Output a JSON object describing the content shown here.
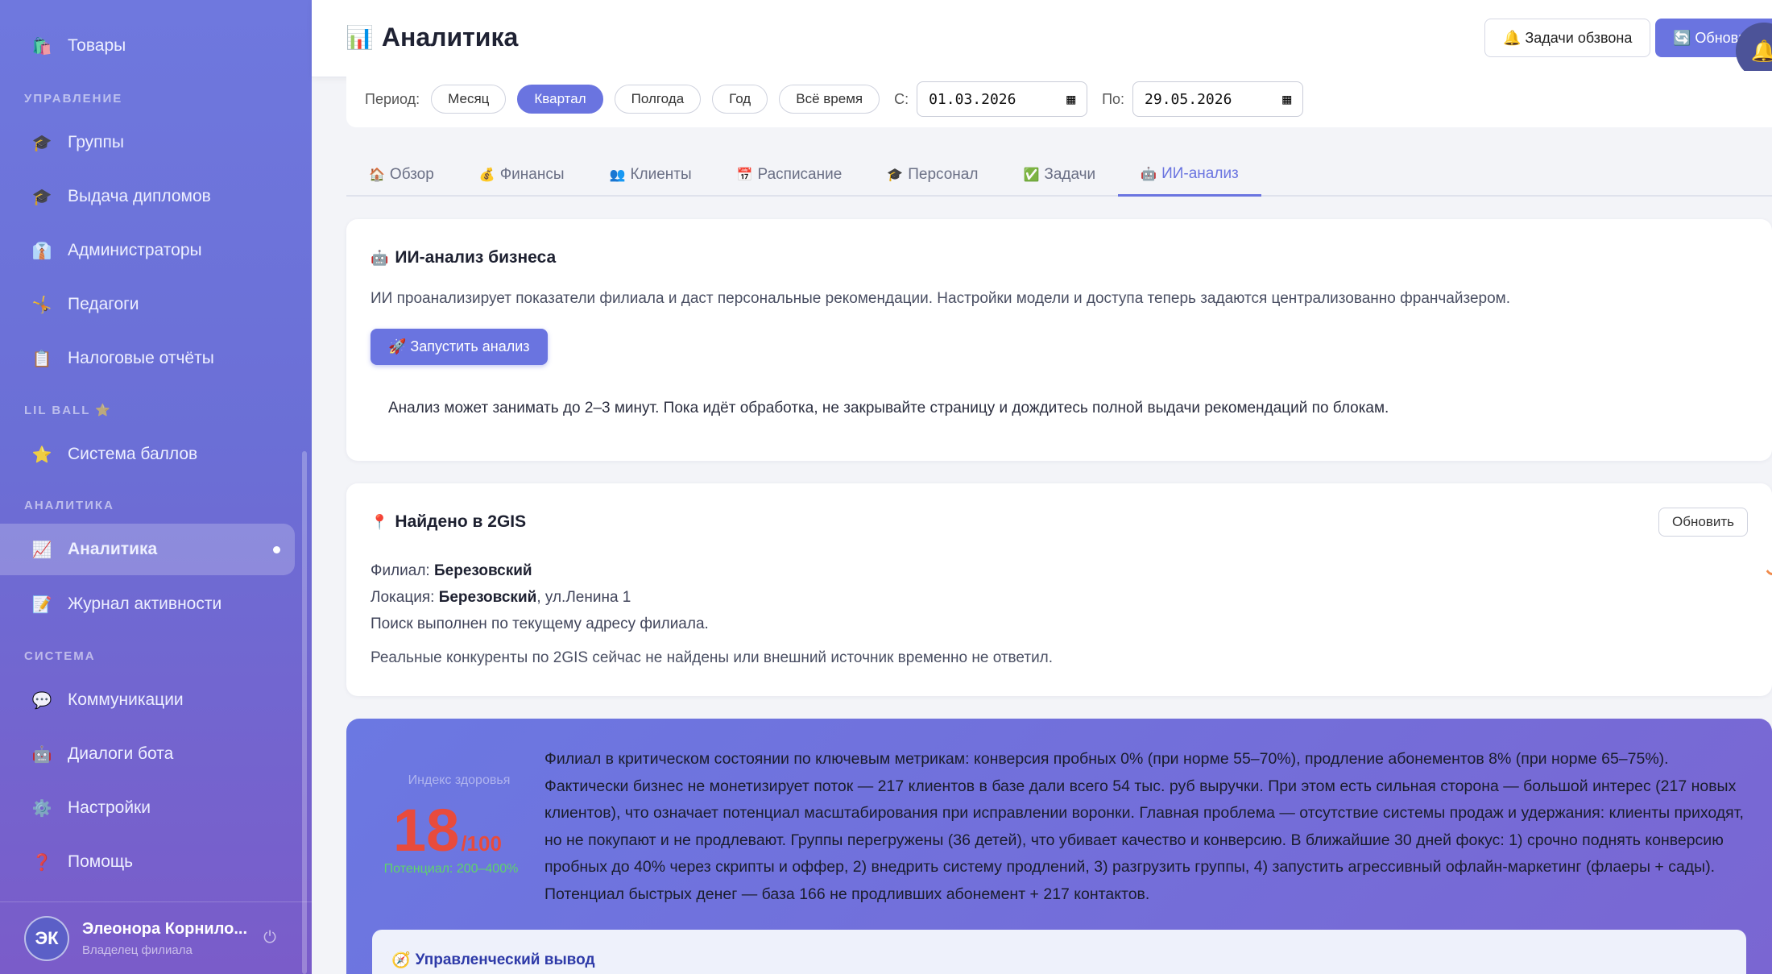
{
  "sidebar": {
    "items": [
      {
        "label": "Товары",
        "icon": "🛍️"
      },
      {
        "label": "Группы",
        "icon": "🎓"
      },
      {
        "label": "Выдача дипломов",
        "icon": "🎓"
      },
      {
        "label": "Администраторы",
        "icon": "👔"
      },
      {
        "label": "Педагоги",
        "icon": "🤸"
      },
      {
        "label": "Налоговые отчёты",
        "icon": "📋"
      },
      {
        "label": "Система баллов",
        "icon": "⭐"
      },
      {
        "label": "Аналитика",
        "icon": "📈"
      },
      {
        "label": "Журнал активности",
        "icon": "📝"
      },
      {
        "label": "Коммуникации",
        "icon": "💬"
      },
      {
        "label": "Диалоги бота",
        "icon": "🤖"
      },
      {
        "label": "Настройки",
        "icon": "⚙️"
      },
      {
        "label": "Помощь",
        "icon": "❓"
      }
    ],
    "sections": {
      "manage": "УПРАВЛЕНИЕ",
      "lilball": "LIL BALL ⭐",
      "analytics": "АНАЛИТИКА",
      "system": "СИСТЕМА"
    },
    "user": {
      "initials": "ЭК",
      "name": "Элеонора Корнило...",
      "role": "Владелец филиала"
    }
  },
  "header": {
    "title": "Аналитика",
    "title_icon": "📊",
    "calls_button": "🔔 Задачи обзвона",
    "refresh_button": "🔄 Обновить"
  },
  "period": {
    "label": "Период:",
    "options": [
      "Месяц",
      "Квартал",
      "Полгода",
      "Год",
      "Всё время"
    ],
    "selected": "Квартал",
    "from_label": "С:",
    "from_value": "01.03.2026",
    "to_label": "По:",
    "to_value": "29.05.2026"
  },
  "tabs": [
    {
      "label": "Обзор",
      "icon": "🏠"
    },
    {
      "label": "Финансы",
      "icon": "💰"
    },
    {
      "label": "Клиенты",
      "icon": "👥"
    },
    {
      "label": "Расписание",
      "icon": "📅"
    },
    {
      "label": "Персонал",
      "icon": "🎓"
    },
    {
      "label": "Задачи",
      "icon": "✅"
    },
    {
      "label": "ИИ-анализ",
      "icon": "🤖"
    }
  ],
  "ai_card": {
    "title": "ИИ-анализ бизнеса",
    "icon": "🤖",
    "description": "ИИ проанализирует показатели филиала и даст персональные рекомендации. Настройки модели и доступа теперь задаются централизованно франчайзером.",
    "run_button": "🚀 Запустить анализ",
    "note": "Анализ может занимать до 2–3 минут. Пока идёт обработка, не закрывайте страницу и дождитесь полной выдачи рекомендаций по блокам."
  },
  "gis_card": {
    "title": "Найдено в 2GIS",
    "icon": "📍",
    "refresh": "Обновить",
    "branch_label": "Филиал:",
    "branch_value": "Березовский",
    "location_label": "Локация:",
    "location_value": "Березовский",
    "location_rest": ", ул.Ленина 1",
    "search_note": "Поиск выполнен по текущему адресу филиала.",
    "footer": "Реальные конкуренты по 2GIS сейчас не найдены или внешний источник временно не ответил."
  },
  "health": {
    "label": "Индекс здоровья",
    "score": "18",
    "max": "/100",
    "potential": "Потенциал: 200–400%",
    "summary": "Филиал в критическом состоянии по ключевым метрикам: конверсия пробных 0% (при норме 55–70%), продление абонементов 8% (при норме 65–75%). Фактически бизнес не монетизирует поток — 217 клиентов в базе дали всего 54 тыс. руб выручки. При этом есть сильная сторона — большой интерес (217 новых клиентов), что означает потенциал масштабирования при исправлении воронки. Главная проблема — отсутствие системы продаж и удержания: клиенты приходят, но не покупают и не продлевают. Группы перегружены (36 детей), что убивает качество и конверсию. В ближайшие 30 дней фокус: 1) срочно поднять конверсию пробных до 40% через скрипты и оффер, 2) внедрить систему продлений, 3) разгрузить группы, 4) запустить агрессивный офлайн-маркетинг (флаеры + сады). Потенциал быстрых денег — база 166 не продливших абонемент + 217 контактов.",
    "management_title": "Управленческий вывод",
    "management_icon": "🧭"
  },
  "colors": {
    "accent": "#6a74e0",
    "score": "#e84b3c",
    "potential": "#5ed46a"
  }
}
